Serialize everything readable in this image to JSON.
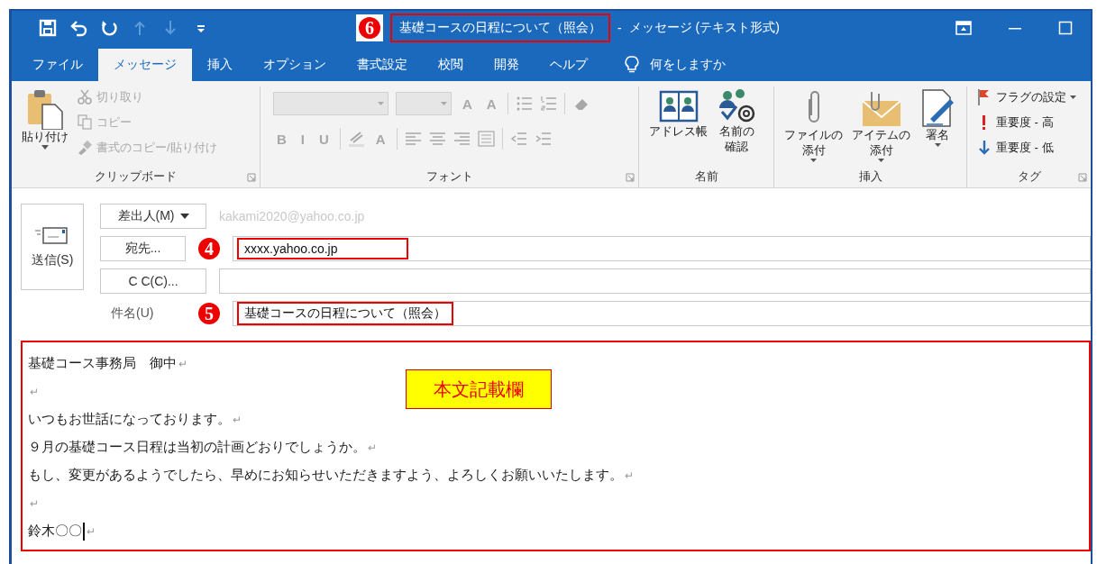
{
  "quick_access": [
    {
      "kind": "save",
      "disabled": false
    },
    {
      "kind": "undo",
      "disabled": false
    },
    {
      "kind": "redo",
      "disabled": false
    },
    {
      "kind": "up",
      "disabled": true
    },
    {
      "kind": "down",
      "disabled": true
    },
    {
      "kind": "customize",
      "disabled": false
    }
  ],
  "window": {
    "title": "基礎コースの日程について（照会）",
    "marker": "6",
    "separator": "-",
    "app": "メッセージ (テキスト形式)"
  },
  "tabs": [
    {
      "label": "ファイル",
      "selected": false
    },
    {
      "label": "メッセージ",
      "selected": true
    },
    {
      "label": "挿入",
      "selected": false
    },
    {
      "label": "オプション",
      "selected": false
    },
    {
      "label": "書式設定",
      "selected": false
    },
    {
      "label": "校閲",
      "selected": false
    },
    {
      "label": "開発",
      "selected": false
    },
    {
      "label": "ヘルプ",
      "selected": false
    }
  ],
  "tell_me": "何をしますか",
  "clipboard": {
    "label": "クリップボード",
    "paste": {
      "label": "貼り付け",
      "disabled": false
    },
    "items": [
      {
        "kind": "cut",
        "label": "切り取り",
        "disabled": true
      },
      {
        "kind": "copy",
        "label": "コピー",
        "disabled": true
      },
      {
        "kind": "painter",
        "label": "書式のコピー/貼り付け",
        "disabled": true
      }
    ]
  },
  "font": {
    "label": "フォント",
    "disabled": true,
    "row_1": [
      {
        "kind": "combo"
      },
      {
        "kind": "combo-small"
      },
      {
        "kind": "glyph",
        "text": "A"
      },
      {
        "kind": "glyph",
        "text": "A"
      },
      {
        "kind": "sep"
      },
      {
        "kind": "bullets"
      },
      {
        "kind": "numbering"
      },
      {
        "kind": "sep"
      },
      {
        "kind": "eraser"
      }
    ],
    "row_2": [
      {
        "kind": "glyph",
        "text": "B"
      },
      {
        "kind": "glyph",
        "text": "I"
      },
      {
        "kind": "glyph",
        "text": "U"
      },
      {
        "kind": "sep"
      },
      {
        "kind": "highlight"
      },
      {
        "kind": "glyph",
        "text": "A"
      },
      {
        "kind": "sep"
      },
      {
        "kind": "align-left"
      },
      {
        "kind": "align-center"
      },
      {
        "kind": "align-right"
      },
      {
        "kind": "justify"
      },
      {
        "kind": "sep"
      },
      {
        "kind": "outdent"
      },
      {
        "kind": "indent"
      }
    ]
  },
  "names": {
    "label": "名前",
    "items": [
      {
        "kind": "address-book",
        "label": "アドレス帳"
      },
      {
        "kind": "check-names",
        "label": "名前の確認"
      }
    ]
  },
  "insert": {
    "label": "挿入",
    "items": [
      {
        "kind": "attach-file",
        "label": "ファイルの添付",
        "dropdown": true
      },
      {
        "kind": "attach-item",
        "label": "アイテムの添付",
        "dropdown": true
      },
      {
        "kind": "signature",
        "label": "署名",
        "dropdown": true
      }
    ]
  },
  "tags": {
    "label": "タグ",
    "items": [
      {
        "kind": "flag",
        "label": "フラグの設定",
        "dropdown": true
      },
      {
        "kind": "high",
        "label": "重要度 - 高",
        "dropdown": false
      },
      {
        "kind": "low",
        "label": "重要度 - 低",
        "dropdown": false
      }
    ]
  },
  "header": {
    "send": "送信(S)",
    "from_button": "差出人(M)",
    "from": "kakami2020@yahoo.co.jp",
    "to_button": "宛先...",
    "to": "xxxx.yahoo.co.jp",
    "to_marker": "4",
    "cc_button": "C C(C)...",
    "subject_label": "件名(U)",
    "subject": "基礎コースの日程について（照会）",
    "subject_marker": "5"
  },
  "body": {
    "highlighted": true,
    "label": "本文記載欄",
    "lines": [
      {
        "text": "基礎コース事務局　御中",
        "mark": "↵"
      },
      {
        "mark": "↵"
      },
      {
        "text": "いつもお世話になっております。",
        "mark": "↵"
      },
      {
        "text": "９月の基礎コース日程は当初の計画どおりでしょうか。",
        "mark": "↵"
      },
      {
        "text": "もし、変更があるようでしたら、早めにお知らせいただきますよう、よろしくお願いいたします。",
        "mark": "↵"
      },
      {
        "mark": "↵"
      },
      {
        "text": "鈴木〇〇",
        "cursor": true,
        "mark": "↵"
      }
    ]
  }
}
